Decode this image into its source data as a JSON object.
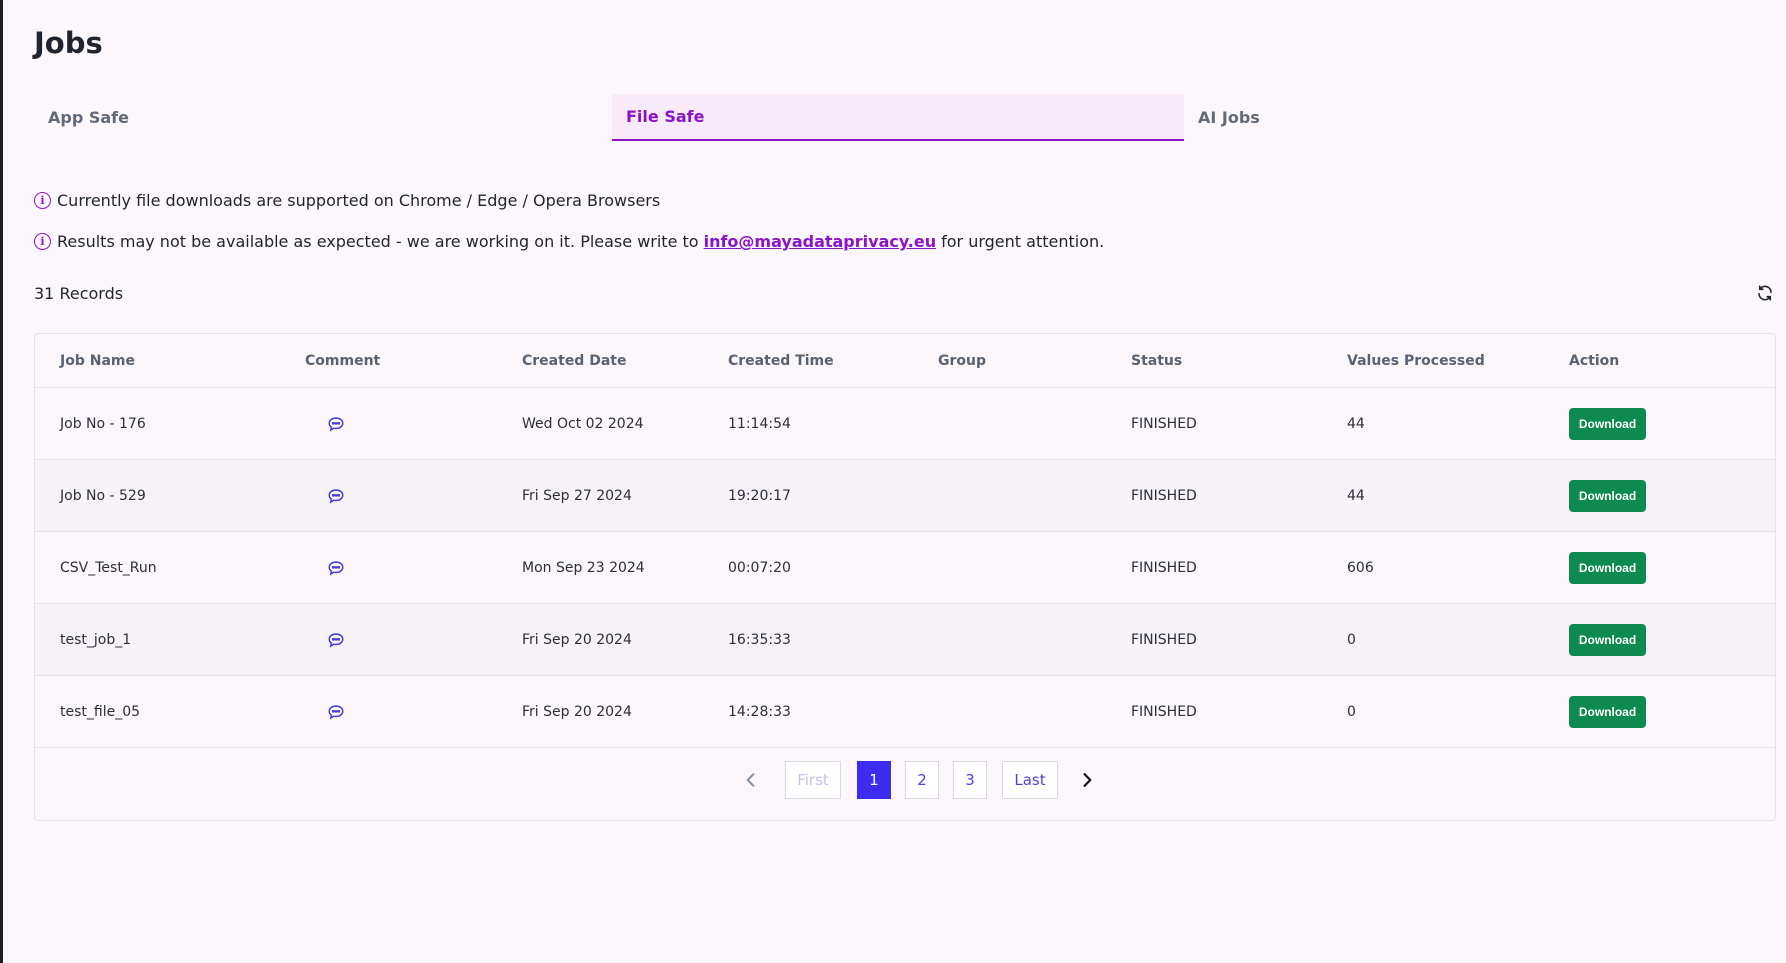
{
  "page": {
    "title": "Jobs"
  },
  "tabs": [
    {
      "label": "App Safe"
    },
    {
      "label": "File Safe"
    },
    {
      "label": "AI Jobs"
    }
  ],
  "notices": {
    "browser_support": "Currently file downloads are supported on Chrome / Edge / Opera Browsers",
    "availability_prefix": "Results may not be available as expected - we are working on it. Please write to",
    "availability_email": "info@mayadataprivacy.eu",
    "availability_suffix": "for urgent attention."
  },
  "records": {
    "label": "31 Records"
  },
  "table": {
    "headers": [
      "Job Name",
      "Comment",
      "Created Date",
      "Created Time",
      "Group",
      "Status",
      "Values Processed",
      "Action"
    ],
    "rows": [
      {
        "job_name": "Job No - 176",
        "created_date": "Wed Oct 02 2024",
        "created_time": "11:14:54",
        "group": "",
        "status": "FINISHED",
        "values_processed": "44",
        "action": "Download"
      },
      {
        "job_name": "Job No - 529",
        "created_date": "Fri Sep 27 2024",
        "created_time": "19:20:17",
        "group": "",
        "status": "FINISHED",
        "values_processed": "44",
        "action": "Download"
      },
      {
        "job_name": "CSV_Test_Run",
        "created_date": "Mon Sep 23 2024",
        "created_time": "00:07:20",
        "group": "",
        "status": "FINISHED",
        "values_processed": "606",
        "action": "Download"
      },
      {
        "job_name": "test_job_1",
        "created_date": "Fri Sep 20 2024",
        "created_time": "16:35:33",
        "group": "",
        "status": "FINISHED",
        "values_processed": "0",
        "action": "Download"
      },
      {
        "job_name": "test_file_05",
        "created_date": "Fri Sep 20 2024",
        "created_time": "14:28:33",
        "group": "",
        "status": "FINISHED",
        "values_processed": "0",
        "action": "Download"
      }
    ]
  },
  "pagination": {
    "first": "First",
    "pages": [
      "1",
      "2",
      "3"
    ],
    "last": "Last",
    "current_page": "1"
  },
  "colors": {
    "accent": "#8a14c6",
    "download": "#0e8a4f",
    "page_current": "#3b2cf0",
    "comment_icon": "#4a3ad8"
  },
  "icons": {
    "info": "info-circle-icon",
    "refresh": "refresh-icon",
    "comment": "comment-bubble-icon",
    "prev": "chevron-left-icon",
    "next": "chevron-right-icon"
  }
}
